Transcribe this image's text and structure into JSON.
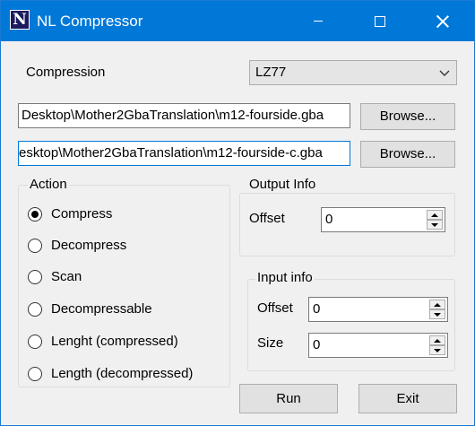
{
  "window": {
    "title": "NL Compressor",
    "icon_letter": "N",
    "icon": "nl-app-icon",
    "titlebar_color": "#0078d7"
  },
  "compression": {
    "label": "Compression",
    "selected": "LZ77"
  },
  "files": {
    "input_path": "Desktop\\Mother2GbaTranslation\\m12-fourside.gba",
    "output_path": "esktop\\Mother2GbaTranslation\\m12-fourside-c.gba",
    "browse_label": "Browse..."
  },
  "action": {
    "title": "Action",
    "options": [
      {
        "label": "Compress",
        "checked": true
      },
      {
        "label": "Decompress",
        "checked": false
      },
      {
        "label": "Scan",
        "checked": false
      },
      {
        "label": "Decompressable",
        "checked": false
      },
      {
        "label": "Lenght (compressed)",
        "checked": false
      },
      {
        "label": "Length (decompressed)",
        "checked": false
      }
    ]
  },
  "output_info": {
    "title": "Output Info",
    "offset_label": "Offset",
    "offset_value": "0"
  },
  "input_info": {
    "title": "Input info",
    "offset_label": "Offset",
    "offset_value": "0",
    "size_label": "Size",
    "size_value": "0"
  },
  "buttons": {
    "run": "Run",
    "exit": "Exit"
  }
}
